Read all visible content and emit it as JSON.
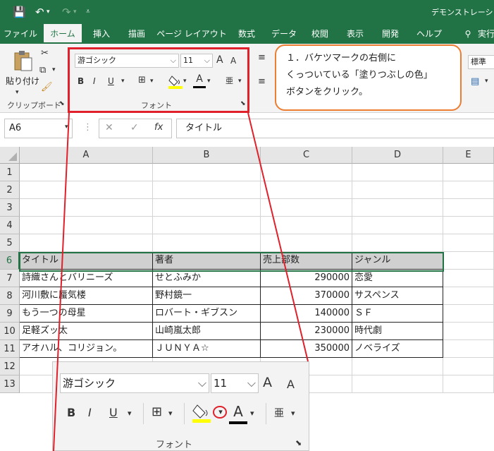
{
  "titlebar": {
    "title": "デモンストレーション"
  },
  "tabs": [
    "ファイル",
    "ホーム",
    "挿入",
    "描画",
    "ページ レイアウト",
    "数式",
    "データ",
    "校閲",
    "表示",
    "開発",
    "ヘルプ",
    "実行"
  ],
  "ribbon": {
    "paste_label": "貼り付け",
    "clipboard_label": "クリップボード",
    "font_name": "游ゴシック",
    "font_size": "11",
    "font_group_label": "フォント",
    "number_format": "標準",
    "bold": "B",
    "italic": "I",
    "underline": "U",
    "font_color_glyph": "A",
    "increase_font": "A",
    "decrease_font": "A",
    "phonetic_glyph": "亜"
  },
  "callout": {
    "line1": "１．バケツマークの右側に",
    "line2": "くっついている「塗りつぶしの色」",
    "line3": "ボタンをクリック。"
  },
  "formula_bar": {
    "name_box": "A6",
    "content": "タイトル",
    "fx": "fx"
  },
  "columns": [
    "A",
    "B",
    "C",
    "D",
    "E"
  ],
  "rows": [
    "1",
    "2",
    "3",
    "4",
    "5",
    "6",
    "7",
    "8",
    "9",
    "10",
    "11",
    "12",
    "13"
  ],
  "table": {
    "headers": [
      "タイトル",
      "著者",
      "売上部数",
      "ジャンル"
    ],
    "data": [
      [
        "詩織さんとバリニーズ",
        "せとふみか",
        "290000",
        "恋愛"
      ],
      [
        "河川敷に蜃気楼",
        "野村鏡一",
        "370000",
        "サスペンス"
      ],
      [
        "もう一つの母星",
        "ロバート・ギブスン",
        "140000",
        "ＳＦ"
      ],
      [
        "足軽ズッ太",
        "山崎嵐太郎",
        "230000",
        "時代劇"
      ],
      [
        "アオハル、コリジョン。",
        "ＪＵＮＹＡ☆",
        "350000",
        "ノベライズ"
      ]
    ]
  },
  "zoom": {
    "font_name": "游ゴシック",
    "font_size": "11",
    "bold": "B",
    "italic": "I",
    "underline": "U",
    "font_color_glyph": "A",
    "increase_font": "A",
    "decrease_font": "A",
    "phonetic_glyph": "亜",
    "group_label": "フォント"
  },
  "colors": {
    "excel_green": "#217346",
    "highlight_red": "#e0202a",
    "callout_orange": "#ed7d31",
    "fill_yellow": "#ffff00"
  }
}
